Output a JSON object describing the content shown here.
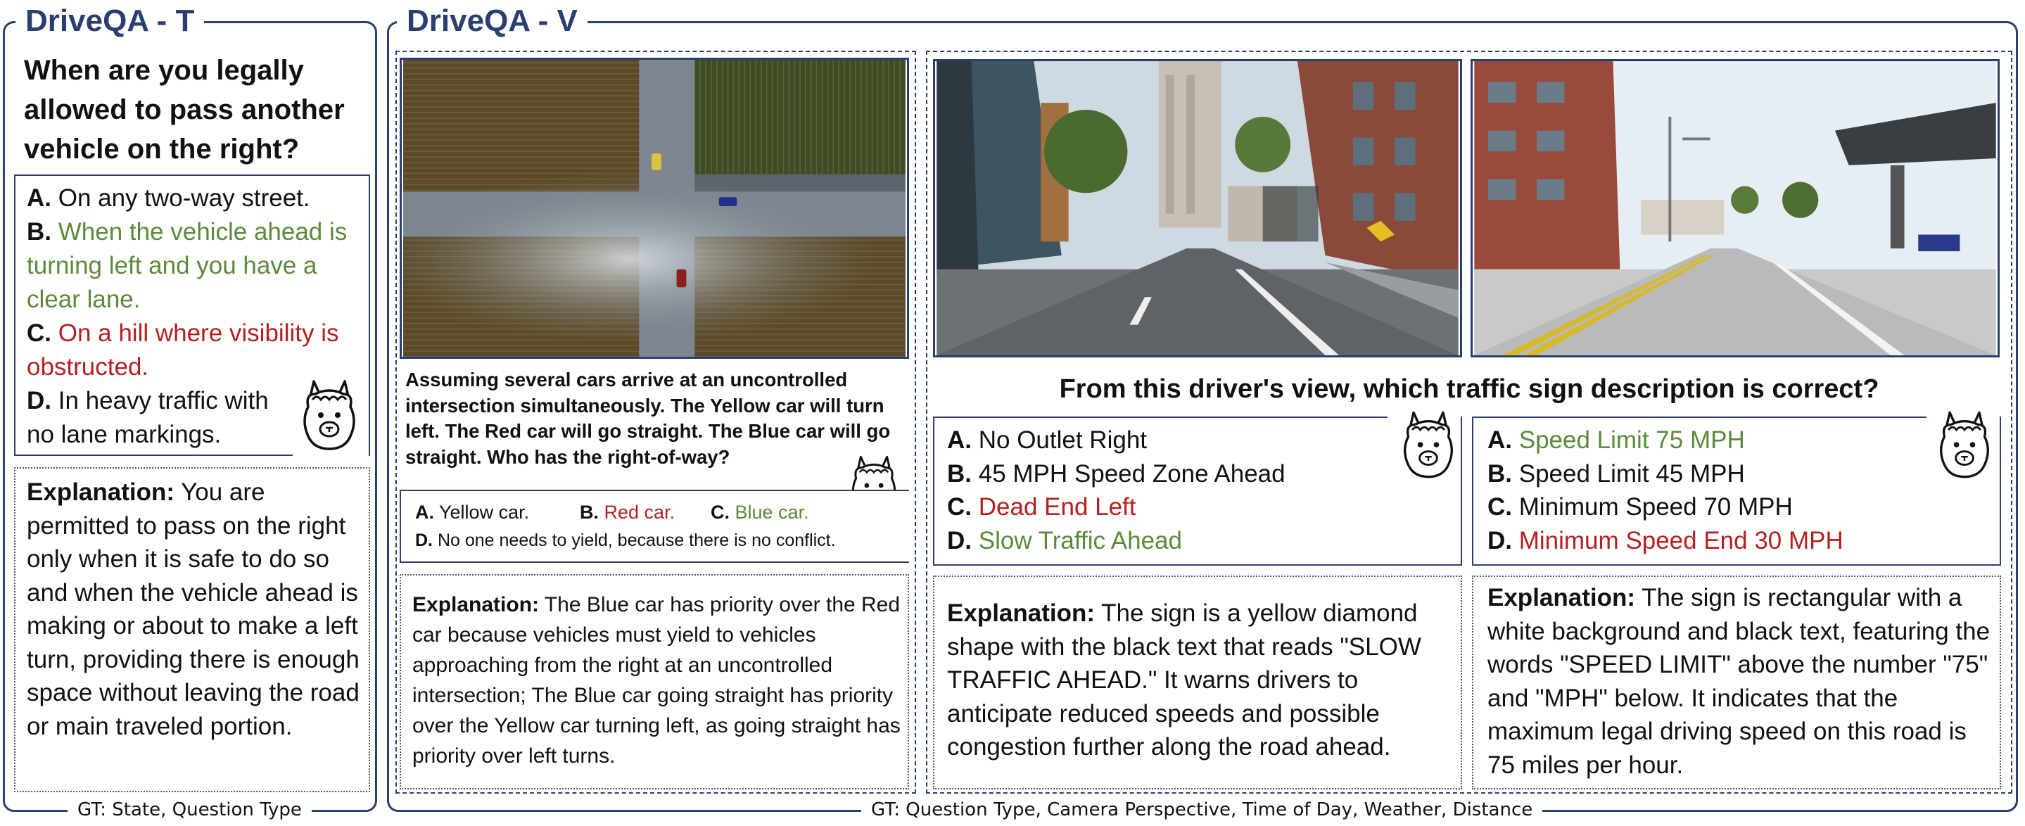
{
  "text_panel": {
    "title": "DriveQA - T",
    "question": "When are you legally allowed to pass another vehicle on the right?",
    "options": [
      {
        "letter": "A.",
        "text": "On any two-way street.",
        "status": "neutral"
      },
      {
        "letter": "B.",
        "text": "When the vehicle ahead is turning left and you have a clear lane.",
        "status": "correct"
      },
      {
        "letter": "C.",
        "text": "On a hill where visibility is obstructed.",
        "status": "wrong"
      },
      {
        "letter": "D.",
        "text": "In heavy traffic with no lane markings.",
        "status": "neutral"
      }
    ],
    "explanation_label": "Explanation:",
    "explanation": "You are permitted to pass on the right only when it is safe to do so and when the vehicle ahead is making or about to make a left turn, providing there is enough space without leaving the road or main traveled portion.",
    "gt_caption": "GT: State, Question Type"
  },
  "vision_panel": {
    "title": "DriveQA - V",
    "gt_caption": "GT: Question Type, Camera Perspective, Time of Day, Weather, Distance",
    "intersection": {
      "question": "Assuming several cars arrive at an uncontrolled intersection simultaneously. The Yellow car will turn left. The Red car will go straight. The Blue car will go straight. Who has the right-of-way?",
      "options": [
        {
          "letter": "A.",
          "text": "Yellow car.",
          "status": "neutral"
        },
        {
          "letter": "B.",
          "text": "Red car.",
          "status": "wrong"
        },
        {
          "letter": "C.",
          "text": "Blue car.",
          "status": "correct"
        },
        {
          "letter": "D.",
          "text": "No one needs to yield, because there is no conflict.",
          "status": "neutral"
        }
      ],
      "explanation_label": "Explanation:",
      "explanation": "The Blue car has priority over the Red car because vehicles must yield to vehicles approaching from the right at an uncontrolled intersection; The Blue car going straight has priority over the Yellow car turning left, as going straight has priority over left turns."
    },
    "sign_question": "From this driver's view, which traffic sign description is correct?",
    "sign_left": {
      "options": [
        {
          "letter": "A.",
          "text": "No Outlet Right",
          "status": "neutral"
        },
        {
          "letter": "B.",
          "text": "45 MPH Speed Zone Ahead",
          "status": "neutral"
        },
        {
          "letter": "C.",
          "text": "Dead End Left",
          "status": "wrong"
        },
        {
          "letter": "D.",
          "text": "Slow Traffic Ahead",
          "status": "correct"
        }
      ],
      "explanation_label": "Explanation:",
      "explanation": "The sign is a yellow diamond shape with the black text that reads \"SLOW TRAFFIC AHEAD.\" It warns drivers to anticipate reduced speeds and possible congestion further along the road ahead."
    },
    "sign_right": {
      "options": [
        {
          "letter": "A.",
          "text": "Speed Limit 75 MPH",
          "status": "correct"
        },
        {
          "letter": "B.",
          "text": "Speed Limit 45 MPH",
          "status": "neutral"
        },
        {
          "letter": "C.",
          "text": "Minimum Speed 70 MPH",
          "status": "neutral"
        },
        {
          "letter": "D.",
          "text": "Minimum Speed End 30 MPH",
          "status": "wrong"
        }
      ],
      "explanation_label": "Explanation:",
      "explanation": "The sign is rectangular with a white background and black text, featuring the words \"SPEED LIMIT\" above the number \"75\" and \"MPH\" below. It indicates that the maximum legal driving speed on this road is 75 miles per hour."
    }
  },
  "colors": {
    "navy": "#2a3f6f",
    "correct": "#5a8a3a",
    "wrong": "#b5201f"
  }
}
